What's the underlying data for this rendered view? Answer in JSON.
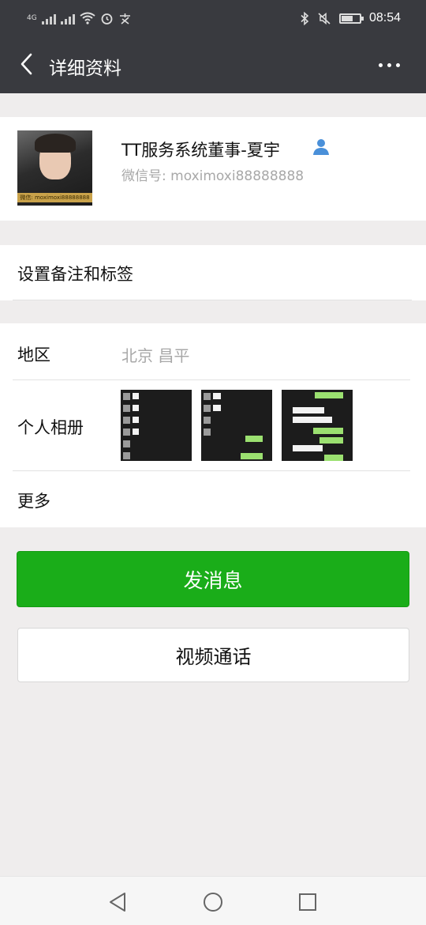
{
  "status_bar": {
    "network": "4G",
    "time": "08:54",
    "icons": [
      "signal-icon",
      "wifi-icon",
      "alarm-icon",
      "app-notification-icon",
      "bluetooth-icon",
      "mute-icon",
      "battery-icon"
    ]
  },
  "header": {
    "title": "详细资料",
    "back_icon": "chevron-left-icon",
    "more_icon": "more-dots-icon"
  },
  "profile": {
    "name": "TT服务系统董事-夏宇",
    "wechat_id": "微信号: moximoxi88888888",
    "avatar_banner": "微信: moximoxi88888888",
    "contact_icon": "contact-person-icon",
    "icon_color": "#4a90d9"
  },
  "remark": {
    "label": "设置备注和标签"
  },
  "details": {
    "region_label": "地区",
    "region_value": "北京  昌平",
    "album_label": "个人相册",
    "more_label": "更多"
  },
  "actions": {
    "message_label": "发消息",
    "video_call_label": "视频通话",
    "primary_color": "#1aad19"
  },
  "nav": {
    "icons": [
      "back-triangle-icon",
      "home-circle-icon",
      "recents-square-icon"
    ]
  }
}
